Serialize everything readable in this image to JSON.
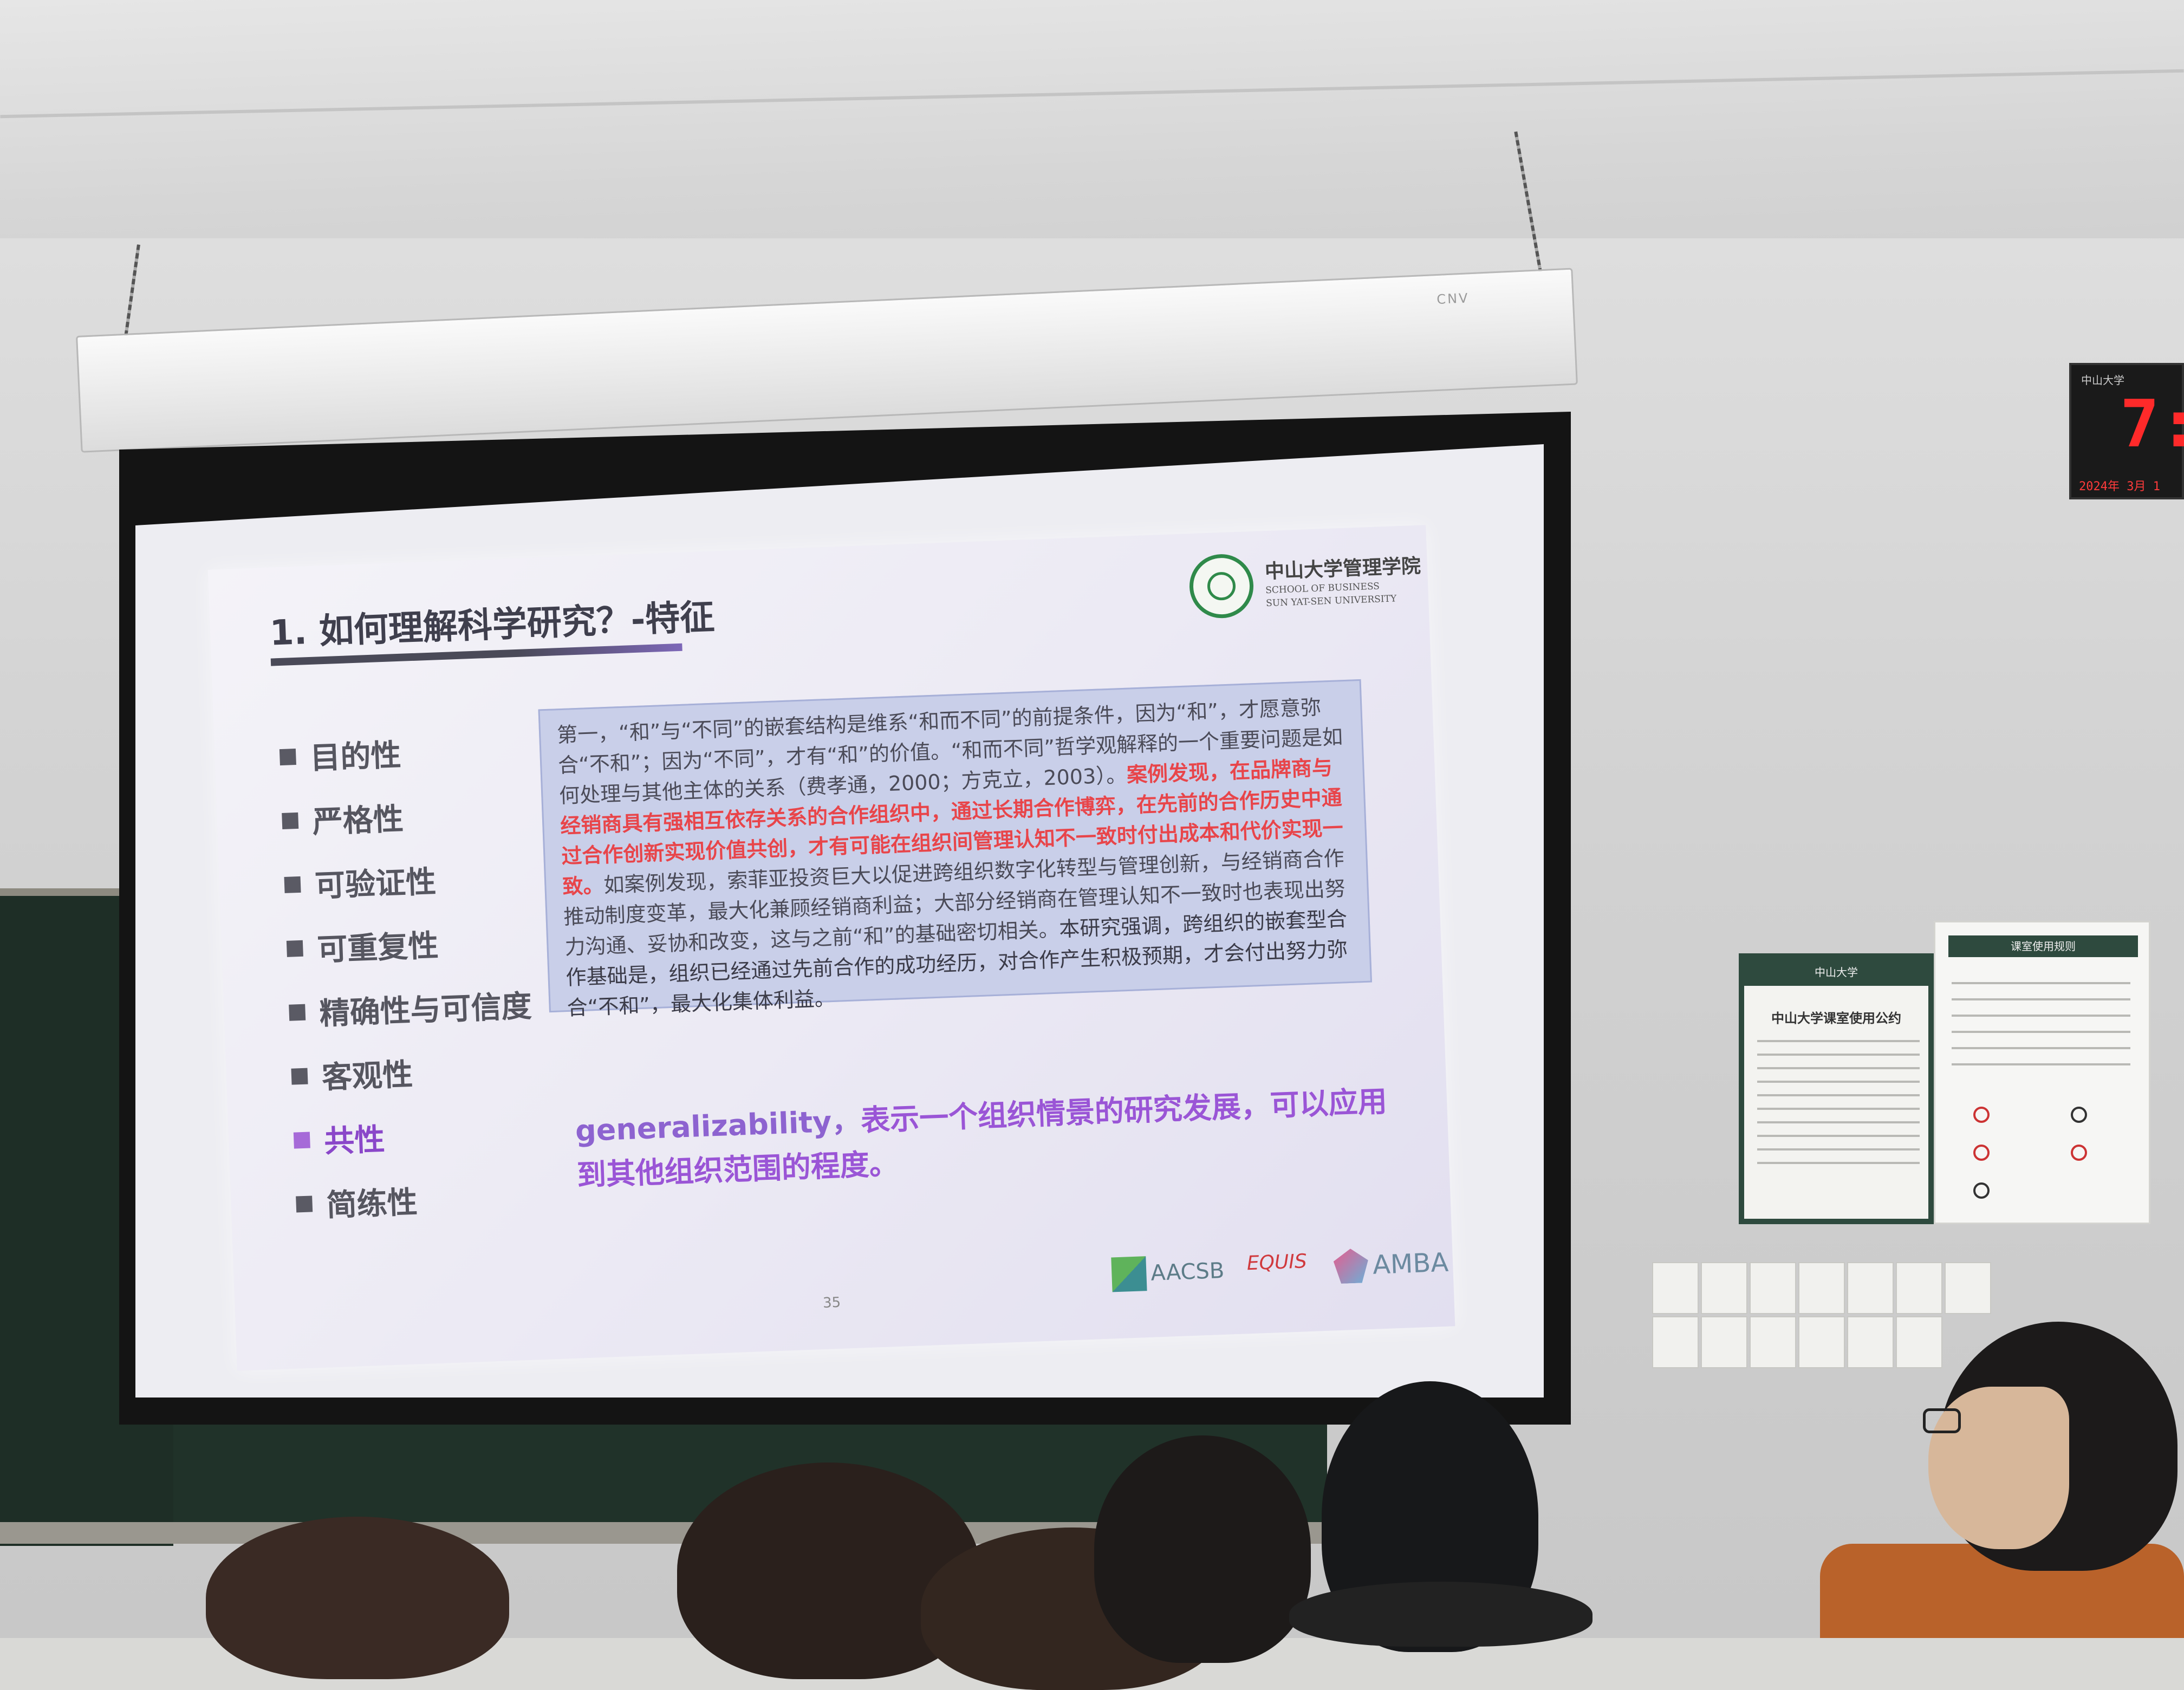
{
  "slide": {
    "title": "1. 如何理解科学研究？-特征",
    "logo": {
      "name_cn": "中山大学管理学院",
      "name_en_line1": "SCHOOL OF BUSINESS",
      "name_en_line2": "SUN YAT-SEN UNIVERSITY"
    },
    "bullets": [
      {
        "label": "目的性"
      },
      {
        "label": "严格性"
      },
      {
        "label": "可验证性"
      },
      {
        "label": "可重复性"
      },
      {
        "label": "精确性与可信度"
      },
      {
        "label": "客观性"
      },
      {
        "label": "共性"
      },
      {
        "label": "简练性"
      }
    ],
    "textbox": {
      "part1": "第一，“和”与“不同”的嵌套结构是维系“和而不同”的前提条件，因为“和”，才愿意弥合“不和”；因为“不同”，才有“和”的价值。“和而不同”哲学观解释的一个重要问题是如何处理与其他主体的关系（费孝通，2000；方克立，2003）。",
      "highlight": "案例发现，在品牌商与经销商具有强相互依存关系的合作组织中，通过长期合作博弈，在先前的合作历史中通过合作创新实现价值共创，才有可能在组织间管理认知不一致时付出成本和代价实现一致。",
      "part2": "如案例发现，索菲亚投资巨大以促进跨组织数字化转型与管理创新，与经销商合作推动制度变革，最大化兼顾经销商利益；大部分经销商在管理认知不一致时也表现出努力沟通、妥协和改变，这与之前“和”的基础密切相关。",
      "part3": "本研究强调，跨组织的嵌套型合作基础是，组织已经通过先前合作的成功经历，对合作产生积极预期，才会付出努力弥合“不和”，最大化集体利益。"
    },
    "generality_en": "generalizability，",
    "generality_cn": "表示一个组织情景的研究发展，可以应用到其他组织范围的程度。",
    "page_number": "35",
    "accreditations": {
      "aacsb": "AACSB",
      "equis": "EQUIS",
      "amba": "AMBA"
    }
  },
  "clock": {
    "brand": "中山大学",
    "time": "7:",
    "date": "2024年 3月 1"
  },
  "notice_left": {
    "header": "中山大学",
    "title": "中山大学课室使用公约"
  },
  "notice_right": {
    "header": "课室使用规则"
  },
  "housing_brand": "CNV",
  "colors": {
    "highlight_red": "#e8454a",
    "accent_purple": "#9a55d6",
    "logo_green": "#2f8a4a",
    "clock_red": "#ff2a2a"
  }
}
